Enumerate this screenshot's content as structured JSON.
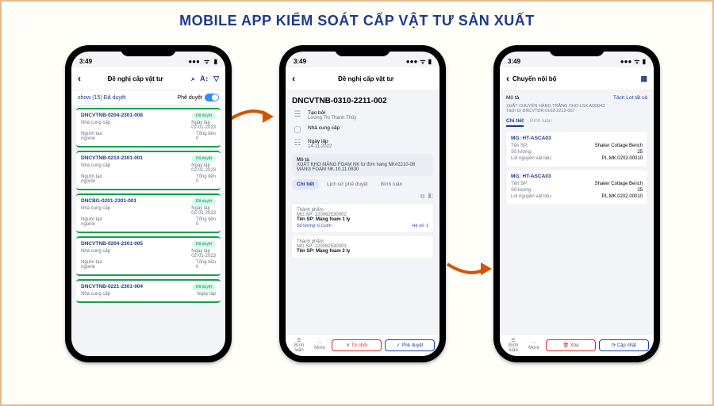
{
  "title": "MOBILE APP KIỂM SOÁT CẤP VẬT TƯ SẢN XUẤT",
  "status": {
    "time": "3:49",
    "signal": "●●●",
    "wifi": "⋮",
    "batt": "▮"
  },
  "p1": {
    "title": "Đề nghị cấp vật tư",
    "show": "show (15) Đã duyệt",
    "approve": "Phê duyệt",
    "items": [
      {
        "id": "DNCVTNB-0204-2301-008",
        "st": "Đã duyệt",
        "ncc": "Nhà cung cấp",
        "date": "02-01-2023",
        "nt": "Người tạo",
        "ntv": "ngonle",
        "tt": "Tổng tiền",
        "ttv": "0"
      },
      {
        "id": "DNCVTNB-0210-2301-001",
        "st": "Đã duyệt",
        "ncc": "Nhà cung cấp",
        "date": "02-01-2023",
        "nt": "Người tạo",
        "ntv": "ngonle",
        "tt": "Tổng tiền",
        "ttv": "0"
      },
      {
        "id": "DNCBG-0201-2301-001",
        "st": "Đã duyệt",
        "ncc": "Nhà cung cấp",
        "date": "02-01-2023",
        "nt": "Người tạo",
        "ntv": "ngonle",
        "tt": "Tổng tiền",
        "ttv": "0"
      },
      {
        "id": "DNCVTNB-0204-2301-005",
        "st": "Đã duyệt",
        "ncc": "Nhà cung cấp",
        "date": "02-01-2023",
        "nt": "Người tạo",
        "ntv": "ngonle",
        "tt": "Tổng tiền",
        "ttv": "0"
      },
      {
        "id": "DNCVTNB-0221-2301-004",
        "st": "Đã duyệt",
        "ncc": "Nhà cung cấp",
        "date": "Ngày lập",
        "nt": "",
        "ntv": "",
        "tt": "",
        "ttv": ""
      }
    ]
  },
  "p2": {
    "title": "Đề nghị cấp vật tư",
    "code": "DNCVTNB-0310-2211-002",
    "tao": "Tạo bởi",
    "taov": "Lương Thị Thanh Thủy",
    "ncc": "Nhà cung cấp",
    "ngay": "Ngày lập",
    "ngayv": "14-11-2022",
    "mota": "Mô tả",
    "motav": "XUẤT KHO MÀNG FOAM NK từ đơn hàng NK#2210-08 MÀNG FOAM NK.10.11.0830",
    "tabs": {
      "a": "Chi tiết",
      "b": "Lịch sử phê duyệt",
      "c": "Bình luận"
    },
    "prod": [
      {
        "tp": "Thành phẩm:",
        "mg": "MG.SP: 120062530002",
        "name": "Tên SP: Màng foam 1 ly",
        "sl": "Số lượng: 6 Cuộn",
        "hs": "Hệ số: 1"
      },
      {
        "tp": "Thành phẩm:",
        "mg": "MG.SP: 120062530003",
        "name": "Tên SP: Màng foam 2 ly",
        "sl": "",
        "hs": ""
      }
    ],
    "bar": {
      "bl": "Bình luận",
      "more": "More",
      "tc": "✕ Từ chối",
      "pd": "✓ Phê duyệt"
    }
  },
  "p3": {
    "title": "Chuyển nội bộ",
    "mota": "Mô tả",
    "tick": "Tách Lot tất cả",
    "sub1": "XUẤT CHUYỂN HÀNG TRẮNG CHO LSX AD0043",
    "sub2": "Tách từ DNCVTDR-0102-2212-007",
    "tabs": {
      "a": "Chi tiết",
      "b": "Bình luận"
    },
    "cards": [
      {
        "hd": "MG: HT-ASCA03",
        "n": "Tên SP:",
        "nv": "Shaker Cottage Bench",
        "q": "Số lượng:",
        "qv": "25",
        "lot": "Lot nguyên vật liệu:",
        "lotv": "PL.MK.0202.00010"
      },
      {
        "hd": "MG: HT-ASCA03",
        "n": "Tên SP:",
        "nv": "Shaker Cottage Bench",
        "q": "Số lượng:",
        "qv": "25",
        "lot": "Lot nguyên vật liệu:",
        "lotv": "PL.MK.0202.00010"
      }
    ],
    "bar": {
      "bl": "Bình luận",
      "more": "More",
      "xoa": "🗑 Xóa",
      "cn": "⟳ Cập nhật"
    }
  }
}
